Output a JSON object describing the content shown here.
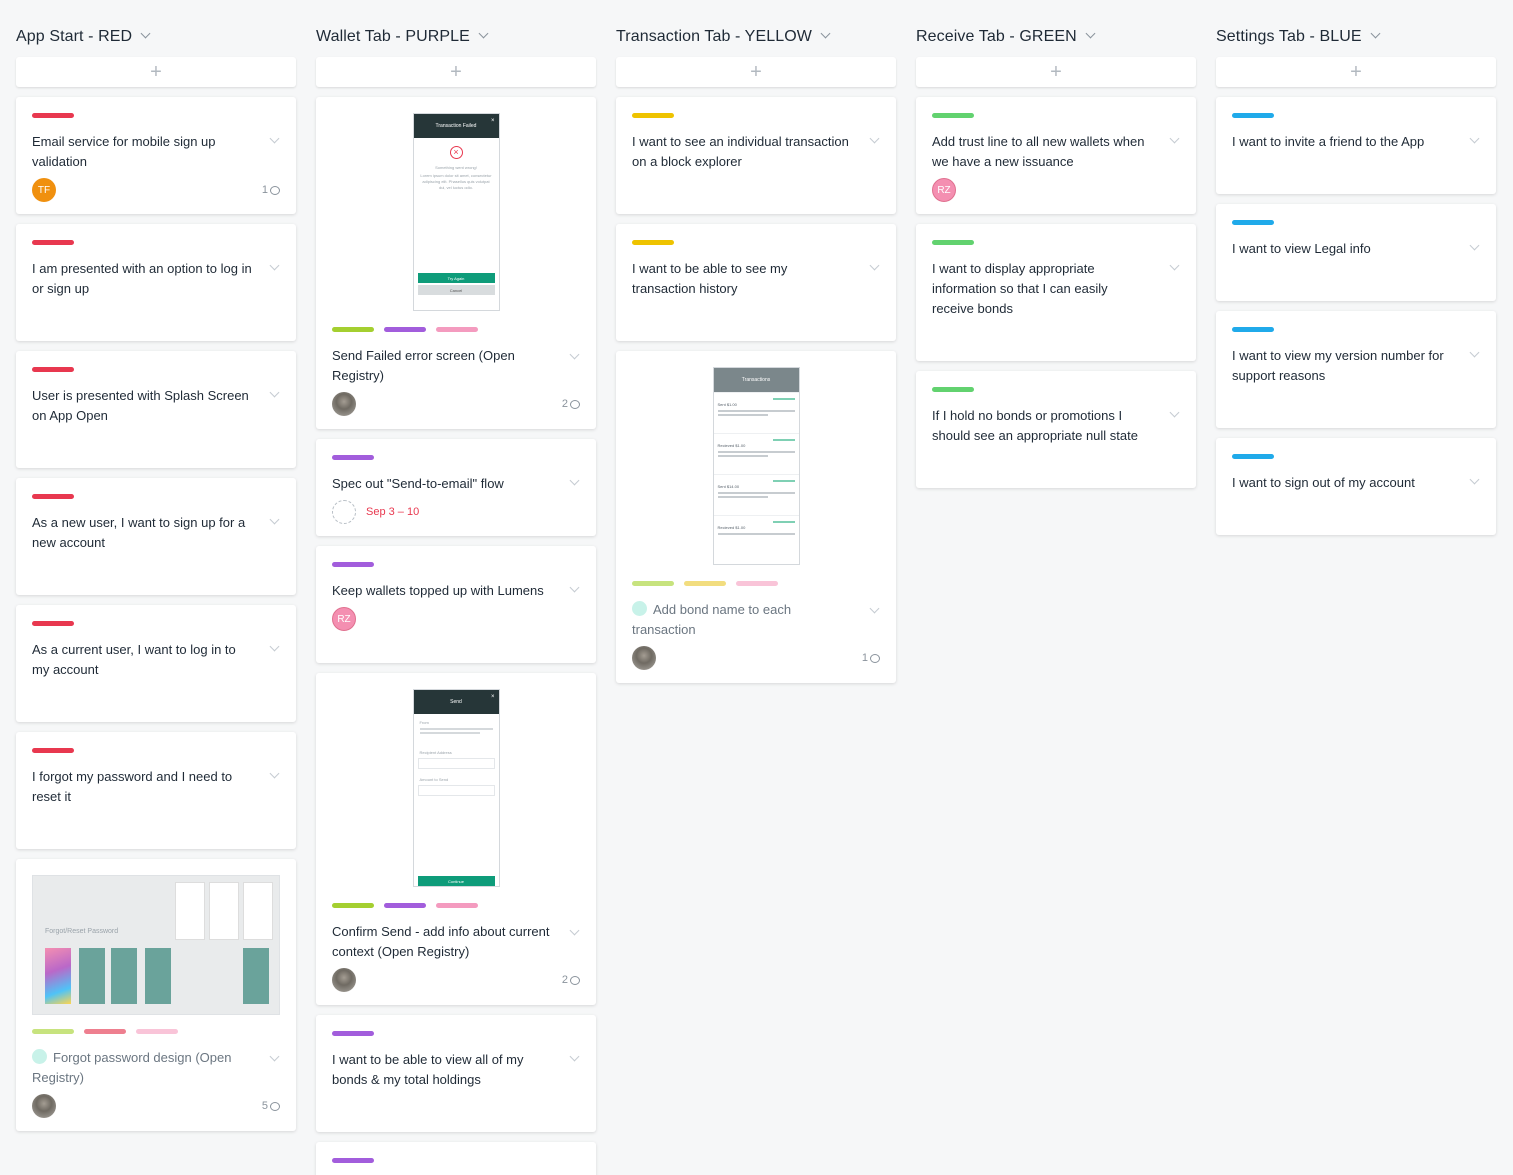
{
  "columns": [
    {
      "title": "App Start - RED",
      "cards": [
        {
          "title": "Email service for mobile sign up validation",
          "avatar": "TF",
          "comments": "1"
        },
        {
          "title": "I am presented with an option to log in or sign up"
        },
        {
          "title": "User is presented with Splash Screen on App Open"
        },
        {
          "title": "As a new user, I want to sign up for a new account"
        },
        {
          "title": "As a current user, I want to log in to my account"
        },
        {
          "title": "I forgot my password and I need to reset it"
        },
        {
          "title": "Forgot password design (Open Registry)",
          "comments": "5",
          "image_caption": "Forgot/Reset Password"
        }
      ]
    },
    {
      "title": "Wallet Tab - PURPLE",
      "cards": [
        {
          "title": "Send Failed error screen (Open Registry)",
          "comments": "2",
          "mock": {
            "header": "Transaction Failed",
            "message": "Something went wrong!",
            "body": "Lorem ipsum dolor sit amet, consectetur adipiscing elit. Phasellus quis volutpat dui, vel luctus odio.",
            "primary": "Try Again",
            "secondary": "Cancel"
          }
        },
        {
          "title": "Spec out \"Send-to-email\" flow",
          "due": "Sep 3 – 10"
        },
        {
          "title": "Keep wallets topped up with Lumens",
          "avatar": "RZ"
        },
        {
          "title": "Confirm Send - add info about current context (Open Registry)",
          "comments": "2",
          "mock": {
            "header": "Send",
            "from_label": "From",
            "recipient_label": "Recipient Address",
            "amount_label": "Amount to Send",
            "button": "Continue"
          }
        },
        {
          "title": "I want to be able to view all of my bonds & my total holdings"
        }
      ]
    },
    {
      "title": "Transaction Tab - YELLOW",
      "cards": [
        {
          "title": "I want to see an individual transaction on a block explorer"
        },
        {
          "title": "I want to be able to see my transaction history"
        },
        {
          "title": "Add bond name to each transaction",
          "comments": "1",
          "mock": {
            "header": "Transactions",
            "rows": [
              "Sent $1.00",
              "Recieved $1.00",
              "Sent $14.00",
              "Recieved $1.00"
            ]
          }
        }
      ]
    },
    {
      "title": "Receive Tab - GREEN",
      "cards": [
        {
          "title": "Add trust line to all new wallets when we have a new issuance",
          "avatar": "RZ"
        },
        {
          "title": "I want to display appropriate information so that I can easily receive bonds"
        },
        {
          "title": "If I hold no bonds or promotions I should see an appropriate null state"
        }
      ]
    },
    {
      "title": "Settings Tab - BLUE",
      "cards": [
        {
          "title": "I want to invite a friend to the App"
        },
        {
          "title": "I want to view Legal info"
        },
        {
          "title": "I want to view my version number for support reasons"
        },
        {
          "title": "I want to sign out of my account"
        }
      ]
    }
  ],
  "add_symbol": "+",
  "colors": {
    "red": "#e8384f",
    "purple": "#a25ddc",
    "yellow": "#eec300",
    "green": "#62d26f",
    "blue": "#20aaea",
    "lime": "#a4cf30",
    "pink": "#f49bbf",
    "pale_lime": "#c7e37e",
    "pale_yellow": "#f2dd7f",
    "pale_pink": "#f9c4d8",
    "salmon": "#ee7f8f"
  }
}
